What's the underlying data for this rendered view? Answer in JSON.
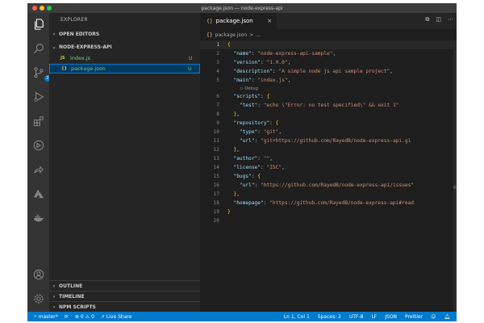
{
  "window": {
    "title": "package.json — node-express-api"
  },
  "colors": {
    "accent": "#007acc",
    "status_bar": "#007acc",
    "untracked": "#73c991"
  },
  "activity_bar": {
    "items": [
      "explorer-icon",
      "search-icon",
      "source-control-icon",
      "run-debug-icon",
      "extensions-icon",
      "remote-icon",
      "live-share-icon",
      "azure-icon",
      "docker-icon"
    ],
    "scm_badge": "2",
    "bottom": [
      "account-icon",
      "settings-icon"
    ]
  },
  "sidebar": {
    "header": "EXPLORER",
    "open_editors": "OPEN EDITORS",
    "project": "NODE-EXPRESS-API",
    "files": [
      {
        "icon": "JS",
        "name": "index.js",
        "status": "U"
      },
      {
        "icon": "{}",
        "name": "package.json",
        "status": "U"
      }
    ],
    "outline": "OUTLINE",
    "timeline": "TIMELINE",
    "npm_scripts": "NPM SCRIPTS"
  },
  "editor": {
    "tab": {
      "icon": "{}",
      "label": "package.json"
    },
    "breadcrumb": {
      "icon": "{}",
      "file": "package.json",
      "separator": ">",
      "item": "..."
    },
    "codelens_debug": "▷ Debug"
  },
  "code": {
    "lines": [
      {
        "n": "1",
        "t": "{"
      },
      {
        "n": "2",
        "t": "  \"name\": \"node-express-api-sample\","
      },
      {
        "n": "3",
        "t": "  \"version\": \"1.0.0\","
      },
      {
        "n": "4",
        "t": "  \"description\": \"A simple node js api sample project\","
      },
      {
        "n": "5",
        "t": "  \"main\": \"index.js\","
      },
      {
        "n": "6",
        "t": "  \"scripts\": {"
      },
      {
        "n": "7",
        "t": "    \"test\": \"echo \\\"Error: no test specified\\\" && exit 1\""
      },
      {
        "n": "8",
        "t": "  },"
      },
      {
        "n": "9",
        "t": "  \"repository\": {"
      },
      {
        "n": "10",
        "t": "    \"type\": \"git\","
      },
      {
        "n": "11",
        "t": "    \"url\": \"git+https://github.com/RayedB/node-express-api.gi"
      },
      {
        "n": "12",
        "t": "  },"
      },
      {
        "n": "13",
        "t": "  \"author\": \"\","
      },
      {
        "n": "14",
        "t": "  \"license\": \"ISC\","
      },
      {
        "n": "15",
        "t": "  \"bugs\": {"
      },
      {
        "n": "16",
        "t": "    \"url\": \"https://github.com/RayedB/node-express-api/issues\""
      },
      {
        "n": "17",
        "t": "  },"
      },
      {
        "n": "18",
        "t": "  \"homepage\": \"https://github.com/RayedB/node-express-api#read"
      },
      {
        "n": "19",
        "t": "}"
      },
      {
        "n": "20",
        "t": ""
      }
    ]
  },
  "status_bar": {
    "branch": "master*",
    "sync_icon": "sync-icon",
    "errors": "0",
    "warnings": "0",
    "live_share": "Live Share",
    "position": "Ln 1, Col 1",
    "spaces": "Spaces: 2",
    "encoding": "UTF-8",
    "eol": "LF",
    "language": "JSON",
    "formatter": "Prettier"
  }
}
